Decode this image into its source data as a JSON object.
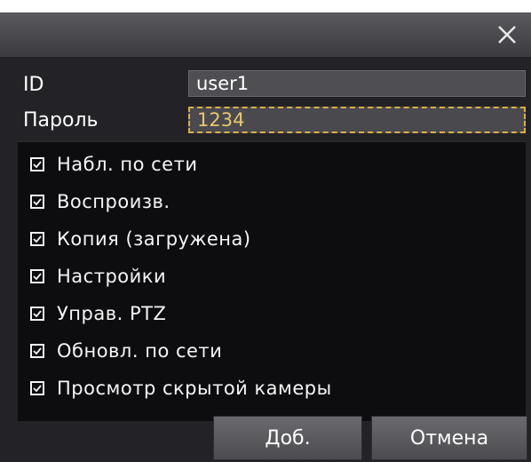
{
  "dialog": {
    "close_icon": "close-icon"
  },
  "fields": {
    "id_label": "ID",
    "id_value": "user1",
    "password_label": "Пароль",
    "password_value": "1234"
  },
  "permissions": [
    {
      "label": "Набл. по сети",
      "checked": true
    },
    {
      "label": "Воспроизв.",
      "checked": true
    },
    {
      "label": "Копия (загружена)",
      "checked": true
    },
    {
      "label": "Настройки",
      "checked": true
    },
    {
      "label": "Управ. PTZ",
      "checked": true
    },
    {
      "label": "Обновл. по сети",
      "checked": true
    },
    {
      "label": "Просмотр скрытой камеры",
      "checked": true
    }
  ],
  "buttons": {
    "add_label": "Доб.",
    "cancel_label": "Отмена"
  },
  "colors": {
    "dialog_bg": "#232327",
    "panel_bg": "#0d0d10",
    "focus_border": "#d8b247"
  }
}
